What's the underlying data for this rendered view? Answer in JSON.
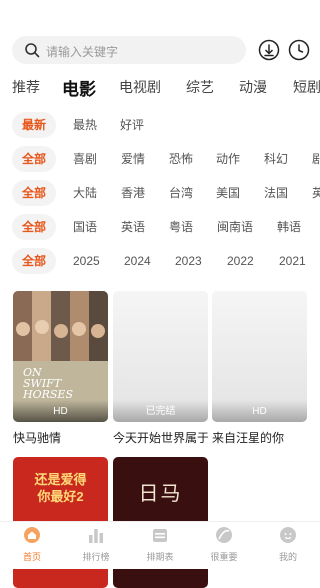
{
  "search": {
    "placeholder": "请输入关键字"
  },
  "tabs": [
    {
      "label": "推荐",
      "active": false
    },
    {
      "label": "电影",
      "active": true
    },
    {
      "label": "电视剧",
      "active": false
    },
    {
      "label": "综艺",
      "active": false
    },
    {
      "label": "动漫",
      "active": false
    },
    {
      "label": "短剧",
      "active": false
    }
  ],
  "filters": {
    "sort": [
      "最新",
      "最热",
      "好评"
    ],
    "genre": [
      "全部",
      "喜剧",
      "爱情",
      "恐怖",
      "动作",
      "科幻",
      "剧"
    ],
    "region": [
      "全部",
      "大陆",
      "香港",
      "台湾",
      "美国",
      "法国",
      "英"
    ],
    "language": [
      "全部",
      "国语",
      "英语",
      "粤语",
      "闽南语",
      "韩语"
    ],
    "year": [
      "全部",
      "2025",
      "2024",
      "2023",
      "2022",
      "2021"
    ]
  },
  "movies": [
    {
      "title": "快马驰情",
      "badge": "HD",
      "poster_text": [
        "ON",
        "SWIFT",
        "HORSES"
      ]
    },
    {
      "title": "今天开始世界属于...",
      "badge": "已完结"
    },
    {
      "title": "来自汪星的你",
      "badge": "HD"
    },
    {
      "title": "",
      "badge": "",
      "poster_text": [
        "还是爱得",
        "你最好2"
      ]
    },
    {
      "title": "",
      "badge": "",
      "poster_text": [
        "日马"
      ]
    }
  ],
  "bottom_nav": [
    {
      "label": "首页",
      "icon": "home-icon",
      "active": true
    },
    {
      "label": "排行榜",
      "icon": "ranking-icon",
      "active": false
    },
    {
      "label": "排期表",
      "icon": "schedule-icon",
      "active": false
    },
    {
      "label": "很重要",
      "icon": "important-icon",
      "active": false
    },
    {
      "label": "我的",
      "icon": "profile-icon",
      "active": false
    }
  ],
  "colors": {
    "accent": "#e8571b",
    "nav_active": "#f07a2c",
    "chip_bg": "#f3f3f3"
  }
}
